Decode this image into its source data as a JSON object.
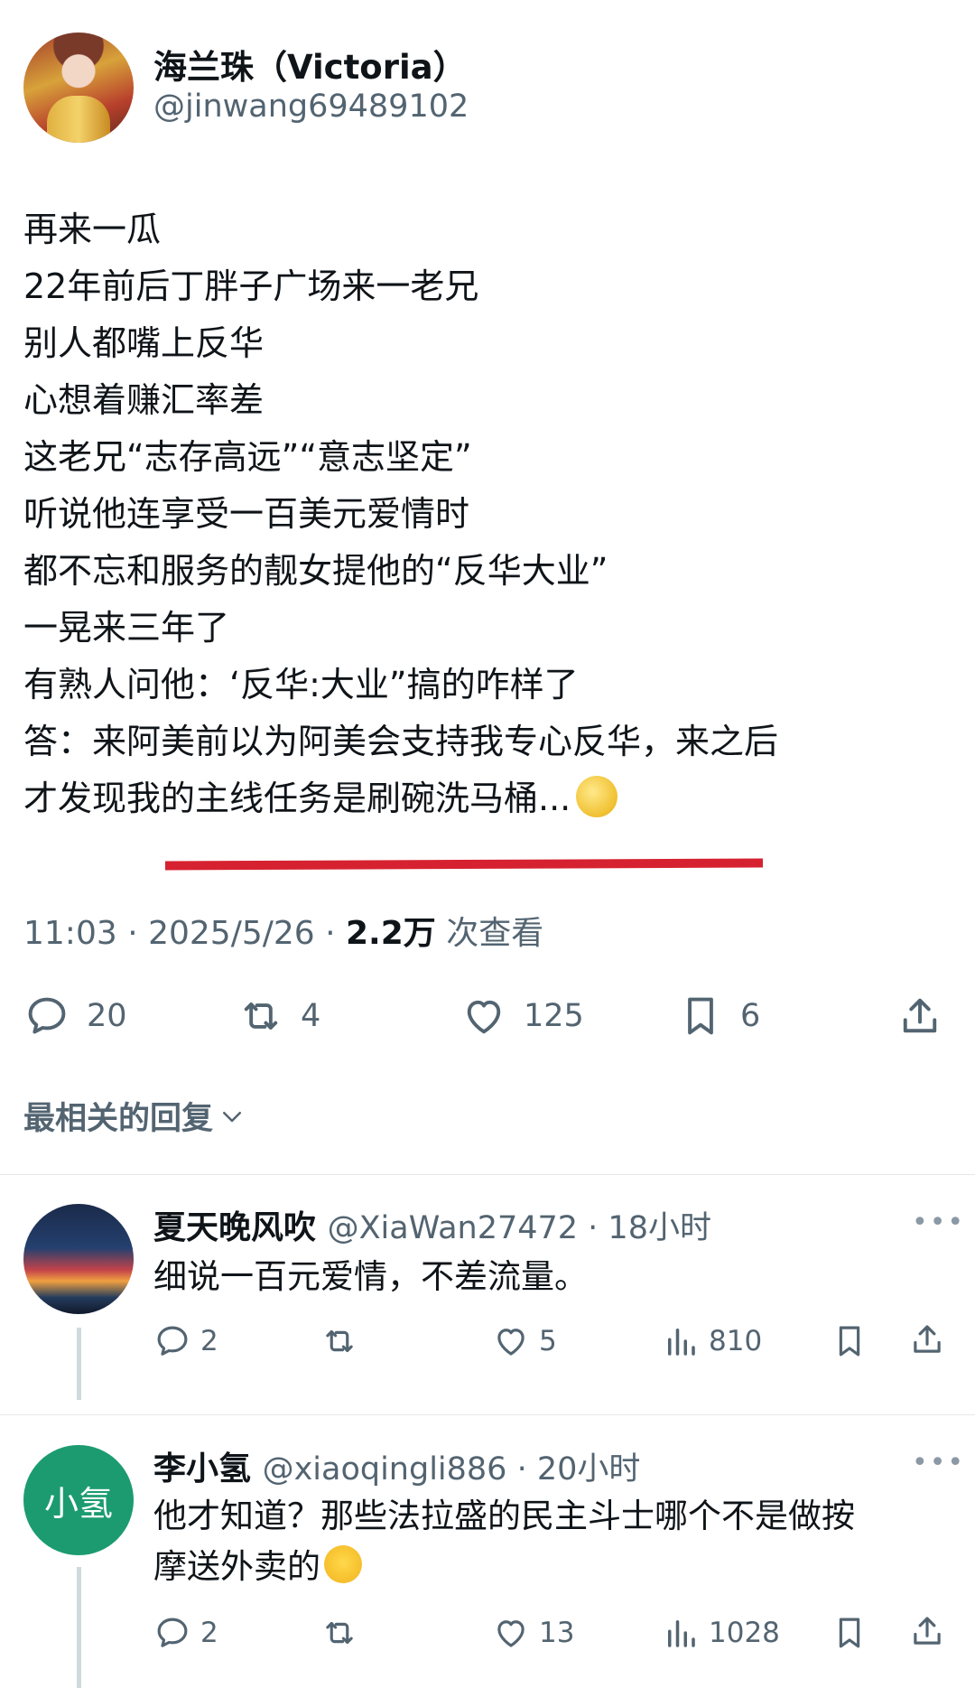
{
  "tweet": {
    "author_name": "海兰珠（Victoria）",
    "author_handle": "@jinwang69489102",
    "lines": [
      "再来一瓜",
      "22年前后丁胖子广场来一老兄",
      "别人都嘴上反华",
      "心想着赚汇率差",
      "这老兄“志存高远”“意志坚定”",
      "听说他连享受一百美元爱情时",
      "都不忘和服务的靓女提他的“反华大业”",
      "一晃来三年了",
      "有熟人问他：‘反华:大业”搞的咋样了",
      "答：来阿美前以为阿美会支持我专心反华，来之后",
      "才发现我的主线任务是刷碗洗马桶..."
    ],
    "time": "11:03 · 2025/5/26 · ",
    "views_count": "2.2万",
    "views_label": " 次查看",
    "replies": "20",
    "retweets": "4",
    "likes": "125",
    "bookmarks": "6",
    "icons": [
      "comment-icon",
      "retweet-icon",
      "heart-icon",
      "bookmark-icon",
      "share-icon",
      "moon-face-emoji"
    ]
  },
  "sort_label": "最相关的回复",
  "replies": [
    {
      "name": "夏天晚风吹",
      "handle": "@XiaWan27472 · 18小时",
      "text": "细说一百元爱情，不差流量。",
      "replies": "2",
      "likes": "5",
      "views": "810"
    },
    {
      "name": "李小氢",
      "avatar_text": "小氢",
      "handle": "@xiaoqingli886 · 20小时",
      "text_line1": "他才知道？那些法拉盛的民主斗士哪个不是做按",
      "text_line2": "摩送外卖的",
      "replies": "2",
      "likes": "13",
      "views": "1028"
    }
  ],
  "colors": {
    "text": "#0f1419",
    "secondary": "#536471",
    "underline": "#d62230",
    "avatar_green": "#1c9b70"
  }
}
